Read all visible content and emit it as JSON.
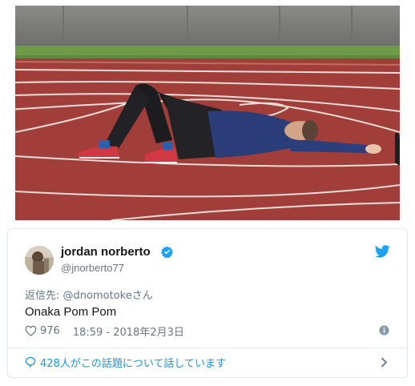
{
  "tweet": {
    "display_name": "jordan norberto",
    "handle": "@jnorberto77",
    "reply_to_prefix": "返信先: ",
    "reply_to_mention": "@dnomotokeさん",
    "text": "Onaka Pom Pom",
    "likes": "976",
    "timestamp": "18:59 - 2018年2月3日",
    "conversation_label": "428人がこの話題について話しています"
  },
  "icons": {
    "verified": "verified-badge-icon",
    "brand": "twitter-bird-icon",
    "like": "heart-icon",
    "info": "info-icon",
    "conversation": "speech-bubble-icon",
    "chevron": "chevron-right-icon"
  },
  "colors": {
    "accent": "#1da1f2",
    "link": "#1b95e0",
    "secondary_text": "#657786",
    "primary_text": "#14171a",
    "border": "#e1e8ed"
  }
}
